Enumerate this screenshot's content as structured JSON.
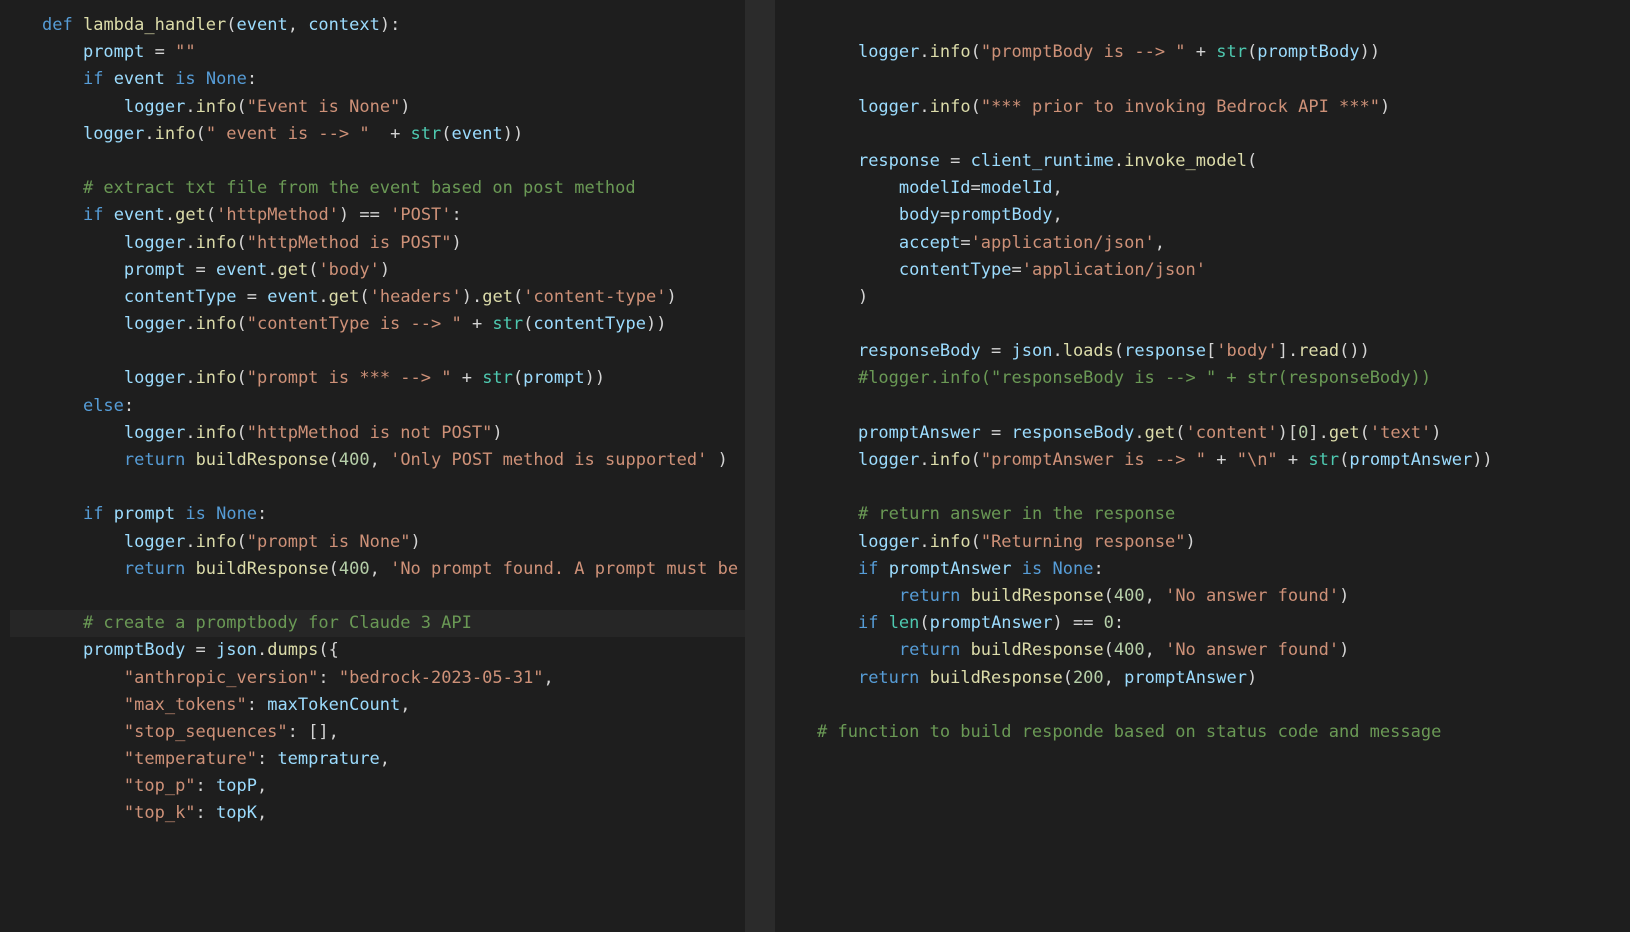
{
  "left": {
    "lines": [
      [
        [
          "kw",
          "def"
        ],
        [
          "op",
          " "
        ],
        [
          "fn",
          "lambda_handler"
        ],
        [
          "punc",
          "("
        ],
        [
          "var",
          "event"
        ],
        [
          "punc",
          ", "
        ],
        [
          "var",
          "context"
        ],
        [
          "punc",
          "):"
        ]
      ],
      [
        [
          "op",
          "    "
        ],
        [
          "var",
          "prompt"
        ],
        [
          "op",
          " = "
        ],
        [
          "str",
          "\"\""
        ]
      ],
      [
        [
          "op",
          "    "
        ],
        [
          "kw",
          "if"
        ],
        [
          "op",
          " "
        ],
        [
          "var",
          "event"
        ],
        [
          "op",
          " "
        ],
        [
          "kw",
          "is"
        ],
        [
          "op",
          " "
        ],
        [
          "const",
          "None"
        ],
        [
          "punc",
          ":"
        ]
      ],
      [
        [
          "op",
          "        "
        ],
        [
          "var",
          "logger"
        ],
        [
          "punc",
          "."
        ],
        [
          "fn",
          "info"
        ],
        [
          "punc",
          "("
        ],
        [
          "str",
          "\"Event is None\""
        ],
        [
          "punc",
          ")"
        ]
      ],
      [
        [
          "op",
          "    "
        ],
        [
          "var",
          "logger"
        ],
        [
          "punc",
          "."
        ],
        [
          "fn",
          "info"
        ],
        [
          "punc",
          "("
        ],
        [
          "str",
          "\" event is --> \""
        ],
        [
          "op",
          "  + "
        ],
        [
          "bi",
          "str"
        ],
        [
          "punc",
          "("
        ],
        [
          "var",
          "event"
        ],
        [
          "punc",
          "))"
        ]
      ],
      [],
      [
        [
          "op",
          "    "
        ],
        [
          "cmt",
          "# extract txt file from the event based on post method"
        ]
      ],
      [
        [
          "op",
          "    "
        ],
        [
          "kw",
          "if"
        ],
        [
          "op",
          " "
        ],
        [
          "var",
          "event"
        ],
        [
          "punc",
          "."
        ],
        [
          "fn",
          "get"
        ],
        [
          "punc",
          "("
        ],
        [
          "str",
          "'httpMethod'"
        ],
        [
          "punc",
          ") == "
        ],
        [
          "str",
          "'POST'"
        ],
        [
          "punc",
          ":"
        ]
      ],
      [
        [
          "op",
          "        "
        ],
        [
          "var",
          "logger"
        ],
        [
          "punc",
          "."
        ],
        [
          "fn",
          "info"
        ],
        [
          "punc",
          "("
        ],
        [
          "str",
          "\"httpMethod is POST\""
        ],
        [
          "punc",
          ")"
        ]
      ],
      [
        [
          "op",
          "        "
        ],
        [
          "var",
          "prompt"
        ],
        [
          "op",
          " = "
        ],
        [
          "var",
          "event"
        ],
        [
          "punc",
          "."
        ],
        [
          "fn",
          "get"
        ],
        [
          "punc",
          "("
        ],
        [
          "str",
          "'body'"
        ],
        [
          "punc",
          ")"
        ]
      ],
      [
        [
          "op",
          "        "
        ],
        [
          "var",
          "contentType"
        ],
        [
          "op",
          " = "
        ],
        [
          "var",
          "event"
        ],
        [
          "punc",
          "."
        ],
        [
          "fn",
          "get"
        ],
        [
          "punc",
          "("
        ],
        [
          "str",
          "'headers'"
        ],
        [
          "punc",
          ")."
        ],
        [
          "fn",
          "get"
        ],
        [
          "punc",
          "("
        ],
        [
          "str",
          "'content-type'"
        ],
        [
          "punc",
          ")"
        ]
      ],
      [
        [
          "op",
          "        "
        ],
        [
          "var",
          "logger"
        ],
        [
          "punc",
          "."
        ],
        [
          "fn",
          "info"
        ],
        [
          "punc",
          "("
        ],
        [
          "str",
          "\"contentType is --> \""
        ],
        [
          "op",
          " + "
        ],
        [
          "bi",
          "str"
        ],
        [
          "punc",
          "("
        ],
        [
          "var",
          "contentType"
        ],
        [
          "punc",
          "))"
        ]
      ],
      [],
      [
        [
          "op",
          "        "
        ],
        [
          "var",
          "logger"
        ],
        [
          "punc",
          "."
        ],
        [
          "fn",
          "info"
        ],
        [
          "punc",
          "("
        ],
        [
          "str",
          "\"prompt is *** --> \""
        ],
        [
          "op",
          " + "
        ],
        [
          "bi",
          "str"
        ],
        [
          "punc",
          "("
        ],
        [
          "var",
          "prompt"
        ],
        [
          "punc",
          "))"
        ]
      ],
      [
        [
          "op",
          "    "
        ],
        [
          "kw",
          "else"
        ],
        [
          "punc",
          ":"
        ]
      ],
      [
        [
          "op",
          "        "
        ],
        [
          "var",
          "logger"
        ],
        [
          "punc",
          "."
        ],
        [
          "fn",
          "info"
        ],
        [
          "punc",
          "("
        ],
        [
          "str",
          "\"httpMethod is not POST\""
        ],
        [
          "punc",
          ")"
        ]
      ],
      [
        [
          "op",
          "        "
        ],
        [
          "kw",
          "return"
        ],
        [
          "op",
          " "
        ],
        [
          "fn",
          "buildResponse"
        ],
        [
          "punc",
          "("
        ],
        [
          "num",
          "400"
        ],
        [
          "punc",
          ", "
        ],
        [
          "str",
          "'Only POST method is supported'"
        ],
        [
          "punc",
          " )"
        ]
      ],
      [],
      [
        [
          "op",
          "    "
        ],
        [
          "kw",
          "if"
        ],
        [
          "op",
          " "
        ],
        [
          "var",
          "prompt"
        ],
        [
          "op",
          " "
        ],
        [
          "kw",
          "is"
        ],
        [
          "op",
          " "
        ],
        [
          "const",
          "None"
        ],
        [
          "punc",
          ":"
        ]
      ],
      [
        [
          "op",
          "        "
        ],
        [
          "var",
          "logger"
        ],
        [
          "punc",
          "."
        ],
        [
          "fn",
          "info"
        ],
        [
          "punc",
          "("
        ],
        [
          "str",
          "\"prompt is None\""
        ],
        [
          "punc",
          ")"
        ]
      ],
      [
        [
          "op",
          "        "
        ],
        [
          "kw",
          "return"
        ],
        [
          "op",
          " "
        ],
        [
          "fn",
          "buildResponse"
        ],
        [
          "punc",
          "("
        ],
        [
          "num",
          "400"
        ],
        [
          "punc",
          ", "
        ],
        [
          "str",
          "'No prompt found. A prompt must be provided to process the request'"
        ],
        [
          "punc",
          ")"
        ]
      ],
      [],
      [
        [
          "op",
          "    "
        ],
        [
          "cmt",
          "# create a promptbody for Claude 3 API"
        ]
      ],
      [
        [
          "op",
          "    "
        ],
        [
          "var",
          "promptBody"
        ],
        [
          "op",
          " = "
        ],
        [
          "var",
          "json"
        ],
        [
          "punc",
          "."
        ],
        [
          "fn",
          "dumps"
        ],
        [
          "punc",
          "({"
        ]
      ],
      [
        [
          "op",
          "        "
        ],
        [
          "str",
          "\"anthropic_version\""
        ],
        [
          "punc",
          ": "
        ],
        [
          "str",
          "\"bedrock-2023-05-31\""
        ],
        [
          "punc",
          ","
        ]
      ],
      [
        [
          "op",
          "        "
        ],
        [
          "str",
          "\"max_tokens\""
        ],
        [
          "punc",
          ": "
        ],
        [
          "var",
          "maxTokenCount"
        ],
        [
          "punc",
          ","
        ]
      ],
      [
        [
          "op",
          "        "
        ],
        [
          "str",
          "\"stop_sequences\""
        ],
        [
          "punc",
          ": [],"
        ]
      ],
      [
        [
          "op",
          "        "
        ],
        [
          "str",
          "\"temperature\""
        ],
        [
          "punc",
          ": "
        ],
        [
          "var",
          "temprature"
        ],
        [
          "punc",
          ","
        ]
      ],
      [
        [
          "op",
          "        "
        ],
        [
          "str",
          "\"top_p\""
        ],
        [
          "punc",
          ": "
        ],
        [
          "var",
          "topP"
        ],
        [
          "punc",
          ","
        ]
      ],
      [
        [
          "op",
          "        "
        ],
        [
          "str",
          "\"top_k\""
        ],
        [
          "punc",
          ": "
        ],
        [
          "var",
          "topK"
        ],
        [
          "punc",
          ","
        ]
      ]
    ],
    "highlight": 22
  },
  "right": {
    "lines": [
      [],
      [
        [
          "op",
          "    "
        ],
        [
          "var",
          "logger"
        ],
        [
          "punc",
          "."
        ],
        [
          "fn",
          "info"
        ],
        [
          "punc",
          "("
        ],
        [
          "str",
          "\"promptBody is --> \""
        ],
        [
          "op",
          " + "
        ],
        [
          "bi",
          "str"
        ],
        [
          "punc",
          "("
        ],
        [
          "var",
          "promptBody"
        ],
        [
          "punc",
          "))"
        ]
      ],
      [],
      [
        [
          "op",
          "    "
        ],
        [
          "var",
          "logger"
        ],
        [
          "punc",
          "."
        ],
        [
          "fn",
          "info"
        ],
        [
          "punc",
          "("
        ],
        [
          "str",
          "\"*** prior to invoking Bedrock API ***\""
        ],
        [
          "punc",
          ")"
        ]
      ],
      [],
      [
        [
          "op",
          "    "
        ],
        [
          "var",
          "response"
        ],
        [
          "op",
          " = "
        ],
        [
          "var",
          "client_runtime"
        ],
        [
          "punc",
          "."
        ],
        [
          "fn",
          "invoke_model"
        ],
        [
          "punc",
          "("
        ]
      ],
      [
        [
          "op",
          "        "
        ],
        [
          "var",
          "modelId"
        ],
        [
          "op",
          "="
        ],
        [
          "var",
          "modelId"
        ],
        [
          "punc",
          ","
        ]
      ],
      [
        [
          "op",
          "        "
        ],
        [
          "var",
          "body"
        ],
        [
          "op",
          "="
        ],
        [
          "var",
          "promptBody"
        ],
        [
          "punc",
          ","
        ]
      ],
      [
        [
          "op",
          "        "
        ],
        [
          "var",
          "accept"
        ],
        [
          "op",
          "="
        ],
        [
          "str",
          "'application/json'"
        ],
        [
          "punc",
          ","
        ]
      ],
      [
        [
          "op",
          "        "
        ],
        [
          "var",
          "contentType"
        ],
        [
          "op",
          "="
        ],
        [
          "str",
          "'application/json'"
        ]
      ],
      [
        [
          "op",
          "    "
        ],
        [
          "punc",
          ")"
        ]
      ],
      [],
      [
        [
          "op",
          "    "
        ],
        [
          "var",
          "responseBody"
        ],
        [
          "op",
          " = "
        ],
        [
          "var",
          "json"
        ],
        [
          "punc",
          "."
        ],
        [
          "fn",
          "loads"
        ],
        [
          "punc",
          "("
        ],
        [
          "var",
          "response"
        ],
        [
          "punc",
          "["
        ],
        [
          "str",
          "'body'"
        ],
        [
          "punc",
          "]."
        ],
        [
          "fn",
          "read"
        ],
        [
          "punc",
          "())"
        ]
      ],
      [
        [
          "op",
          "    "
        ],
        [
          "cmt",
          "#logger.info(\"responseBody is --> \" + str(responseBody))"
        ]
      ],
      [],
      [
        [
          "op",
          "    "
        ],
        [
          "var",
          "promptAnswer"
        ],
        [
          "op",
          " = "
        ],
        [
          "var",
          "responseBody"
        ],
        [
          "punc",
          "."
        ],
        [
          "fn",
          "get"
        ],
        [
          "punc",
          "("
        ],
        [
          "str",
          "'content'"
        ],
        [
          "punc",
          ")["
        ],
        [
          "num",
          "0"
        ],
        [
          "punc",
          "]."
        ],
        [
          "fn",
          "get"
        ],
        [
          "punc",
          "("
        ],
        [
          "str",
          "'text'"
        ],
        [
          "punc",
          ")"
        ]
      ],
      [
        [
          "op",
          "    "
        ],
        [
          "var",
          "logger"
        ],
        [
          "punc",
          "."
        ],
        [
          "fn",
          "info"
        ],
        [
          "punc",
          "("
        ],
        [
          "str",
          "\"promptAnswer is --> \""
        ],
        [
          "op",
          " + "
        ],
        [
          "str",
          "\"\\n\""
        ],
        [
          "op",
          " + "
        ],
        [
          "bi",
          "str"
        ],
        [
          "punc",
          "("
        ],
        [
          "var",
          "promptAnswer"
        ],
        [
          "punc",
          "))"
        ]
      ],
      [],
      [
        [
          "op",
          "    "
        ],
        [
          "cmt",
          "# return answer in the response"
        ]
      ],
      [
        [
          "op",
          "    "
        ],
        [
          "var",
          "logger"
        ],
        [
          "punc",
          "."
        ],
        [
          "fn",
          "info"
        ],
        [
          "punc",
          "("
        ],
        [
          "str",
          "\"Returning response\""
        ],
        [
          "punc",
          ")"
        ]
      ],
      [
        [
          "op",
          "    "
        ],
        [
          "kw",
          "if"
        ],
        [
          "op",
          " "
        ],
        [
          "var",
          "promptAnswer"
        ],
        [
          "op",
          " "
        ],
        [
          "kw",
          "is"
        ],
        [
          "op",
          " "
        ],
        [
          "const",
          "None"
        ],
        [
          "punc",
          ":"
        ]
      ],
      [
        [
          "op",
          "        "
        ],
        [
          "kw",
          "return"
        ],
        [
          "op",
          " "
        ],
        [
          "fn",
          "buildResponse"
        ],
        [
          "punc",
          "("
        ],
        [
          "num",
          "400"
        ],
        [
          "punc",
          ", "
        ],
        [
          "str",
          "'No answer found'"
        ],
        [
          "punc",
          ")"
        ]
      ],
      [
        [
          "op",
          "    "
        ],
        [
          "kw",
          "if"
        ],
        [
          "op",
          " "
        ],
        [
          "bi",
          "len"
        ],
        [
          "punc",
          "("
        ],
        [
          "var",
          "promptAnswer"
        ],
        [
          "punc",
          ") == "
        ],
        [
          "num",
          "0"
        ],
        [
          "punc",
          ":"
        ]
      ],
      [
        [
          "op",
          "        "
        ],
        [
          "kw",
          "return"
        ],
        [
          "op",
          " "
        ],
        [
          "fn",
          "buildResponse"
        ],
        [
          "punc",
          "("
        ],
        [
          "num",
          "400"
        ],
        [
          "punc",
          ", "
        ],
        [
          "str",
          "'No answer found'"
        ],
        [
          "punc",
          ")"
        ]
      ],
      [
        [
          "op",
          "    "
        ],
        [
          "kw",
          "return"
        ],
        [
          "op",
          " "
        ],
        [
          "fn",
          "buildResponse"
        ],
        [
          "punc",
          "("
        ],
        [
          "num",
          "200"
        ],
        [
          "punc",
          ", "
        ],
        [
          "var",
          "promptAnswer"
        ],
        [
          "punc",
          ")"
        ]
      ],
      [],
      [
        [
          "cmt",
          "# function to build responde based on status code and message"
        ]
      ]
    ]
  }
}
